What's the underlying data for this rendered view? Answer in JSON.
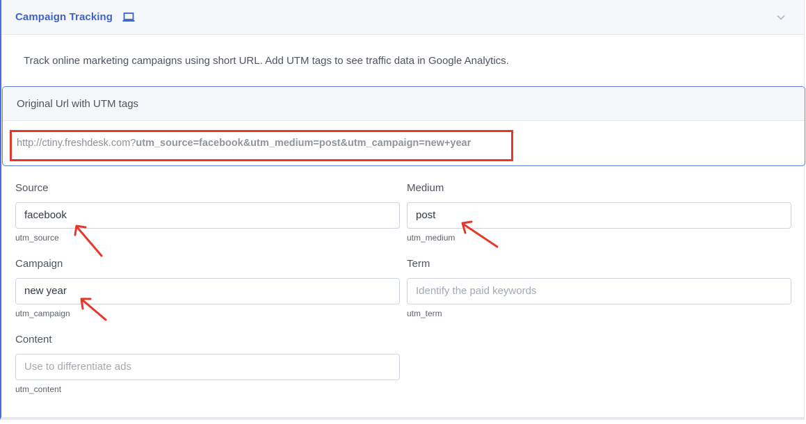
{
  "panel": {
    "title": "Campaign Tracking",
    "title_icon": "laptop-icon",
    "toggle_icon": "chevron-down-icon",
    "description": "Track online marketing campaigns using short URL. Add UTM tags to see traffic data in Google Analytics."
  },
  "url_box": {
    "title": "Original Url with UTM tags",
    "base": "http://ctiny.freshdesk.com?",
    "params": "utm_source=facebook&utm_medium=post&utm_campaign=new+year"
  },
  "fields": {
    "source": {
      "label": "Source",
      "value": "facebook",
      "hint": "utm_source"
    },
    "medium": {
      "label": "Medium",
      "value": "post",
      "hint": "utm_medium"
    },
    "campaign": {
      "label": "Campaign",
      "value": "new year",
      "hint": "utm_campaign"
    },
    "term": {
      "label": "Term",
      "value": "",
      "placeholder": "Identify the paid keywords",
      "hint": "utm_term"
    },
    "content": {
      "label": "Content",
      "value": "",
      "placeholder": "Use to differentiate ads",
      "hint": "utm_content"
    }
  },
  "colors": {
    "accent": "#3f64c9",
    "annotation": "#e6382a"
  }
}
